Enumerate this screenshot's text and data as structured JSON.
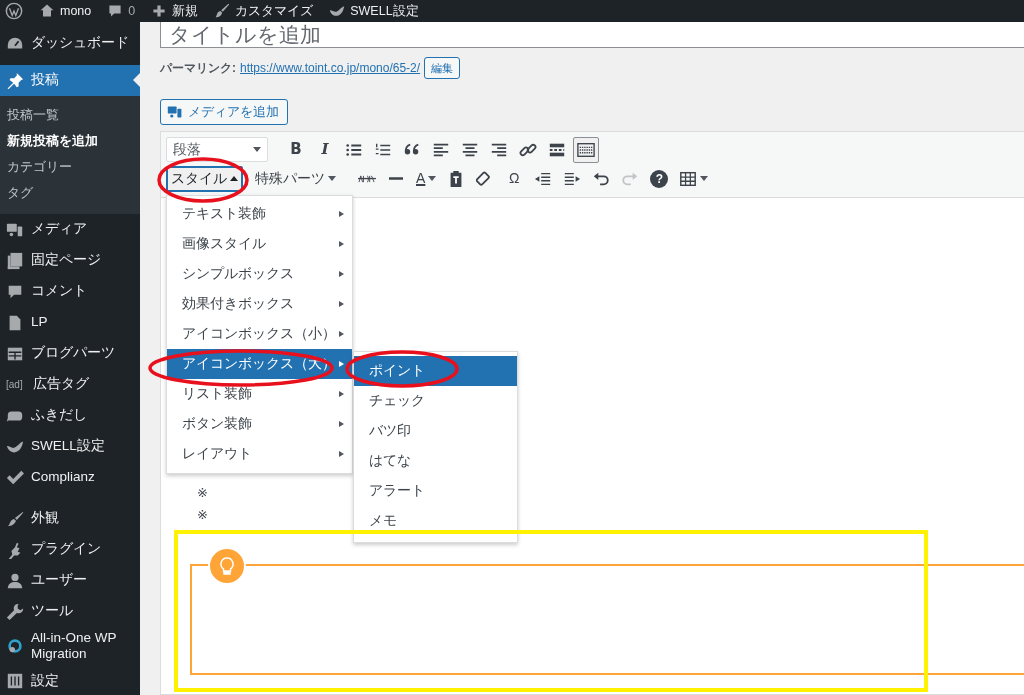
{
  "admin_bar": {
    "items": [
      {
        "kind": "wp-logo"
      },
      {
        "kind": "home",
        "label": "mono"
      },
      {
        "kind": "comments",
        "label": "0"
      },
      {
        "kind": "new",
        "label": "新規"
      },
      {
        "kind": "customize",
        "label": "カスタマイズ"
      },
      {
        "kind": "swell",
        "label": "SWELL設定"
      }
    ]
  },
  "sidebar": {
    "items": [
      {
        "kind": "dashboard",
        "label": "ダッシュボード",
        "selected": false
      },
      {
        "kind": "posts",
        "label": "投稿",
        "selected": true,
        "children": [
          {
            "label": "投稿一覧",
            "selected": false
          },
          {
            "label": "新規投稿を追加",
            "selected": true
          },
          {
            "label": "カテゴリー",
            "selected": false
          },
          {
            "label": "タグ",
            "selected": false
          }
        ]
      },
      {
        "kind": "media",
        "label": "メディア",
        "selected": false
      },
      {
        "kind": "pages",
        "label": "固定ページ",
        "selected": false
      },
      {
        "kind": "comments",
        "label": "コメント",
        "selected": false
      },
      {
        "kind": "lp",
        "label": "LP",
        "selected": false
      },
      {
        "kind": "blog-parts",
        "label": "ブログパーツ",
        "selected": false
      },
      {
        "kind": "ad",
        "icon_text": "[ad]",
        "label": "広告タグ",
        "selected": false
      },
      {
        "kind": "balloon",
        "label": "ふきだし",
        "selected": false
      },
      {
        "kind": "swell",
        "label": "SWELL設定",
        "selected": false
      },
      {
        "kind": "complianz",
        "label": "Complianz",
        "selected": false
      },
      {
        "kind": "separator"
      },
      {
        "kind": "appearance",
        "label": "外観",
        "selected": false
      },
      {
        "kind": "plugins",
        "label": "プラグイン",
        "selected": false
      },
      {
        "kind": "users",
        "label": "ユーザー",
        "selected": false
      },
      {
        "kind": "tools",
        "label": "ツール",
        "selected": false
      },
      {
        "kind": "migration",
        "label": "All-in-One WP Migration",
        "selected": false
      },
      {
        "kind": "settings",
        "label": "設定",
        "selected": false
      }
    ]
  },
  "title_field": {
    "placeholder": "タイトルを追加"
  },
  "permalink": {
    "label": "パーマリンク:",
    "url": "https://www.toint.co.jp/mono/65-2/",
    "edit_button": "編集"
  },
  "media_button": "メディアを追加",
  "toolbar": {
    "rows": [
      [
        {
          "kind": "select",
          "label": "段落",
          "active": false,
          "disabled": false
        },
        {
          "kind": "bold",
          "glyph": "B",
          "active": false,
          "disabled": false
        },
        {
          "kind": "italic",
          "glyph": "I",
          "active": false,
          "disabled": false
        },
        {
          "kind": "bullist",
          "active": false,
          "disabled": false
        },
        {
          "kind": "numlist",
          "active": false,
          "disabled": false
        },
        {
          "kind": "quote",
          "active": false,
          "disabled": false
        },
        {
          "kind": "alignleft",
          "active": false,
          "disabled": false
        },
        {
          "kind": "aligncenter",
          "active": false,
          "disabled": false
        },
        {
          "kind": "alignright",
          "active": false,
          "disabled": false
        },
        {
          "kind": "link",
          "active": false,
          "disabled": false
        },
        {
          "kind": "more",
          "active": false,
          "disabled": false
        },
        {
          "kind": "toggle",
          "active": true,
          "disabled": false
        }
      ],
      [
        {
          "kind": "menu",
          "label": "スタイル",
          "active": true,
          "disabled": false
        },
        {
          "kind": "dropdown",
          "label": "特殊パーツ",
          "active": false,
          "disabled": false
        },
        {
          "kind": "strike",
          "active": false,
          "disabled": false
        },
        {
          "kind": "hr",
          "active": false,
          "disabled": false
        },
        {
          "kind": "textcolor",
          "glyph": "A",
          "active": false,
          "disabled": false
        },
        {
          "kind": "paste",
          "active": false,
          "disabled": false
        },
        {
          "kind": "eraser",
          "active": false,
          "disabled": false
        },
        {
          "kind": "charmap",
          "glyph": "Ω",
          "active": false,
          "disabled": false
        },
        {
          "kind": "outdent",
          "active": false,
          "disabled": false
        },
        {
          "kind": "indent",
          "active": false,
          "disabled": false
        },
        {
          "kind": "undo",
          "active": false,
          "disabled": false
        },
        {
          "kind": "redo",
          "active": false,
          "disabled": true
        },
        {
          "kind": "help",
          "glyph": "?",
          "active": false,
          "disabled": false
        },
        {
          "kind": "table",
          "active": false,
          "disabled": false
        }
      ]
    ]
  },
  "style_menu": {
    "items": [
      {
        "label": "テキスト装飾",
        "selected": false
      },
      {
        "label": "画像スタイル",
        "selected": false
      },
      {
        "label": "シンプルボックス",
        "selected": false
      },
      {
        "label": "効果付きボックス",
        "selected": false
      },
      {
        "label": "アイコンボックス（小）",
        "selected": false
      },
      {
        "label": "アイコンボックス（大）",
        "selected": true
      },
      {
        "label": "リスト装飾",
        "selected": false
      },
      {
        "label": "ボタン装飾",
        "selected": false
      },
      {
        "label": "レイアウト",
        "selected": false
      }
    ]
  },
  "submenu": {
    "items": [
      {
        "label": "ポイント",
        "selected": true
      },
      {
        "label": "チェック",
        "selected": false
      },
      {
        "label": "バツ印",
        "selected": false
      },
      {
        "label": "はてな",
        "selected": false
      },
      {
        "label": "アラート",
        "selected": false
      },
      {
        "label": "メモ",
        "selected": false
      }
    ]
  },
  "editor_content": {
    "lines": [
      "※",
      "※"
    ],
    "icon_box": {
      "kind": "point"
    }
  },
  "annotations": [
    {
      "kind": "ellipse"
    },
    {
      "kind": "ellipse"
    },
    {
      "kind": "ellipse"
    },
    {
      "kind": "rectangle"
    }
  ]
}
